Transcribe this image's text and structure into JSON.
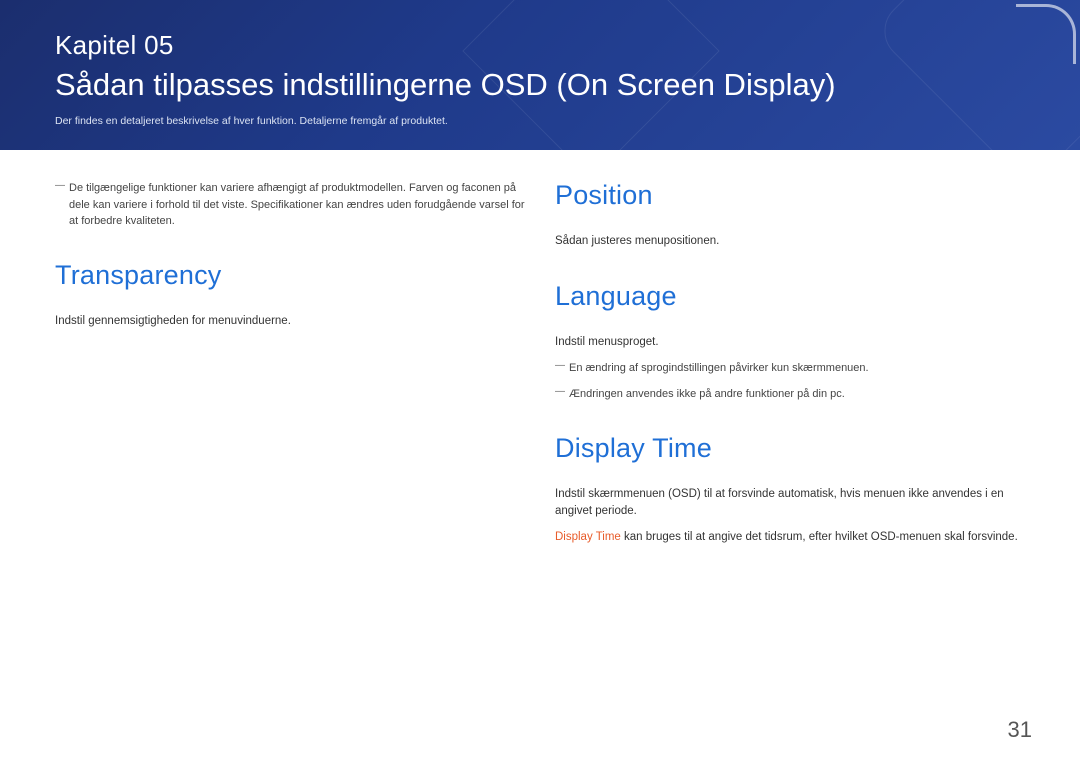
{
  "header": {
    "chapter_label": "Kapitel 05",
    "title": "Sådan tilpasses indstillingerne OSD (On Screen Display)",
    "subtitle": "Der findes en detaljeret beskrivelse af hver funktion. Detaljerne fremgår af produktet."
  },
  "left": {
    "top_note": "De tilgængelige funktioner kan variere afhængigt af produktmodellen. Farven og faconen på dele kan variere i forhold til det viste. Specifikationer kan ændres uden forudgående varsel for at forbedre kvaliteten.",
    "transparency": {
      "heading": "Transparency",
      "body": "Indstil gennemsigtigheden for menuvinduerne."
    }
  },
  "right": {
    "position": {
      "heading": "Position",
      "body": "Sådan justeres menupositionen."
    },
    "language": {
      "heading": "Language",
      "body": "Indstil menusproget.",
      "note1": "En ændring af sprogindstillingen påvirker kun skærmmenuen.",
      "note2": "Ændringen anvendes ikke på andre funktioner på din pc."
    },
    "display_time": {
      "heading": "Display Time",
      "body1": "Indstil skærmmenuen (OSD) til at forsvinde automatisk, hvis menuen ikke anvendes i en angivet periode.",
      "body2_hl": "Display Time",
      "body2_rest": " kan bruges til at angive det tidsrum, efter hvilket OSD-menuen skal forsvinde."
    }
  },
  "page_number": "31"
}
